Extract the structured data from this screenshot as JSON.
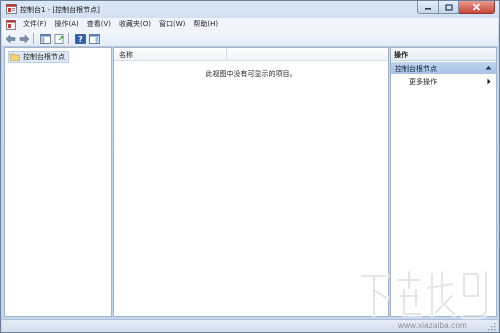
{
  "window": {
    "title": "控制台1 - [控制台根节点]"
  },
  "menu": {
    "items": [
      "文件(F)",
      "操作(A)",
      "查看(V)",
      "收藏夹(O)",
      "窗口(W)",
      "帮助(H)"
    ]
  },
  "toolbar": {
    "buttons": [
      "back-arrow-icon",
      "forward-arrow-icon",
      "show-hide-tree-icon",
      "export-list-icon",
      "help-icon",
      "show-hide-action-pane-icon"
    ]
  },
  "tree": {
    "root_label": "控制台根节点"
  },
  "list": {
    "column_name": "名称",
    "empty_message": "此视图中没有可显示的项目。"
  },
  "actions": {
    "header": "操作",
    "section": "控制台根节点",
    "more_actions": "更多操作"
  },
  "watermark": {
    "url": "www.xiazaiba.com"
  },
  "colors": {
    "window_frame": "#c4d5ec",
    "close_button": "#c7483a",
    "selection": "#dde9f7",
    "action_section": "#a8c2e6"
  }
}
